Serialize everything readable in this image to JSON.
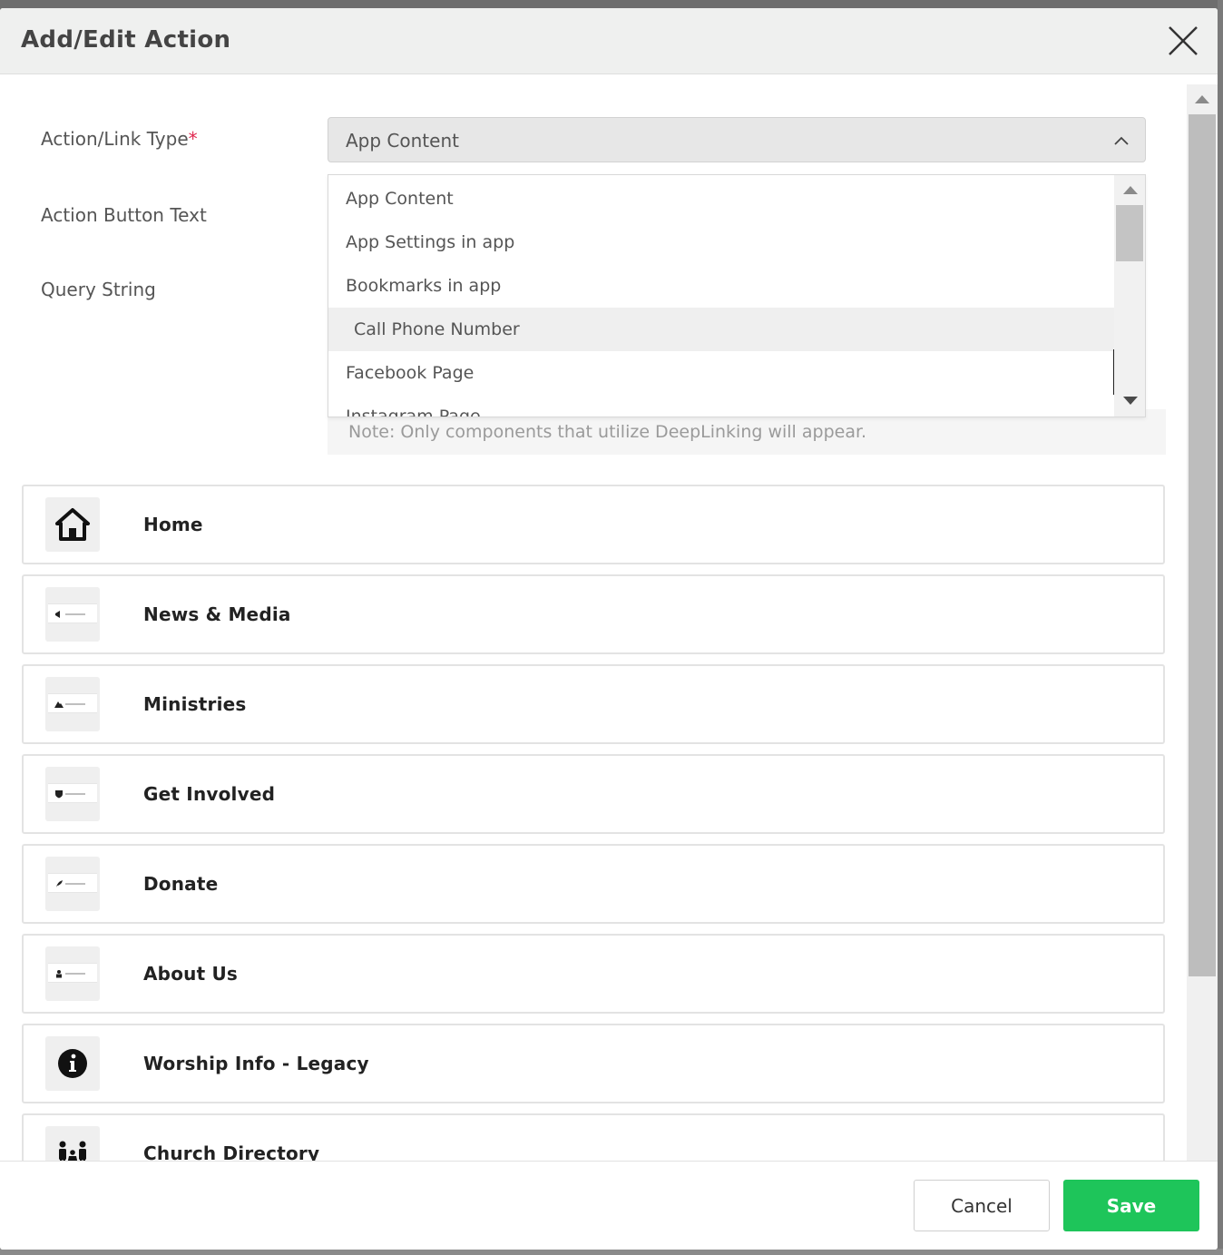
{
  "modal": {
    "title": "Add/Edit Action",
    "close_icon": "close-x-icon"
  },
  "form": {
    "action_link_type_label": "Action/Link Type",
    "required_marker": "*",
    "action_button_text_label": "Action Button Text",
    "query_string_label": "Query String",
    "selected_type": "App Content",
    "chevron_icon": "chevron-up-icon",
    "note": "Note: Only components that utilize DeepLinking will appear."
  },
  "dropdown": {
    "options": [
      "App Content",
      "App Settings in app",
      "Bookmarks in app",
      "Call Phone Number",
      "Facebook Page",
      "Instagram Page"
    ],
    "hovered_index": 3
  },
  "content_items": [
    {
      "label": "Home",
      "icon": "home-icon"
    },
    {
      "label": "News & Media",
      "icon": "megaphone-icon"
    },
    {
      "label": "Ministries",
      "icon": "mountain-icon"
    },
    {
      "label": "Get Involved",
      "icon": "heart-shield-icon"
    },
    {
      "label": "Donate",
      "icon": "feather-icon"
    },
    {
      "label": "About Us",
      "icon": "person-icon"
    },
    {
      "label": "Worship Info - Legacy",
      "icon": "info-icon"
    },
    {
      "label": "Church Directory",
      "icon": "family-icon"
    }
  ],
  "footer": {
    "cancel_label": "Cancel",
    "save_label": "Save"
  },
  "colors": {
    "save_green": "#1ec55a",
    "required_red": "#e0284f",
    "header_bg": "#eff0ef"
  }
}
